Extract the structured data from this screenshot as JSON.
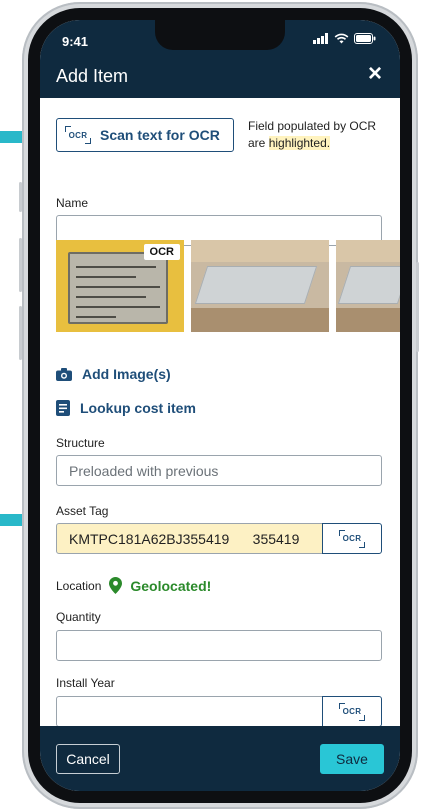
{
  "status_bar": {
    "time": "9:41"
  },
  "header": {
    "title": "Add Item",
    "close_icon": "×"
  },
  "ocr": {
    "button_label": "Scan text for OCR",
    "icon_text": "OCR",
    "note_before": "Field populated by OCR are ",
    "note_highlight": "highlighted.",
    "image_tag": "OCR"
  },
  "fields": {
    "name_label": "Name",
    "name_value": "",
    "structure_label": "Structure",
    "structure_placeholder": "Preloaded with previous",
    "asset_tag_label": "Asset Tag",
    "asset_tag_value": "KMTPC181A62BJ355419      355419",
    "location_label": "Location",
    "location_status": "Geolocated!",
    "quantity_label": "Quantity",
    "quantity_value": "",
    "install_year_label": "Install Year",
    "install_year_value": ""
  },
  "actions": {
    "add_images": "Add Image(s)",
    "lookup_cost": "Lookup cost item",
    "cancel": "Cancel",
    "save": "Save"
  },
  "colors": {
    "header_bg": "#0f2a3f",
    "accent": "#1f4e79",
    "highlight": "#fdf1c4",
    "save_bg": "#29c6d6",
    "geo_green": "#2b8a2b",
    "arrow": "#29b8c9"
  },
  "icons": [
    "signal-icon",
    "wifi-icon",
    "battery-icon",
    "close-icon",
    "camera-icon",
    "document-icon",
    "location-pin-icon",
    "ocr-scan-icon"
  ]
}
